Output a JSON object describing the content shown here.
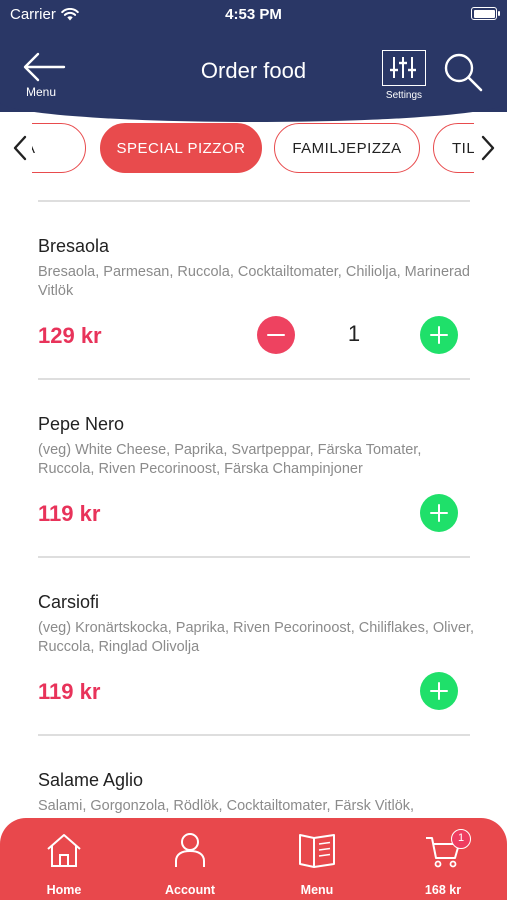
{
  "status_bar": {
    "carrier": "Carrier",
    "time": "4:53 PM"
  },
  "header": {
    "back_label": "Menu",
    "title": "Order food",
    "settings_label": "Settings"
  },
  "categories": {
    "tabs": [
      "PIZZA",
      "SPECIAL PIZZOR",
      "FAMILJEPIZZA",
      "TILLBEHÖR"
    ],
    "active_index": 1
  },
  "items": [
    {
      "name": "Bresaola",
      "description": "Bresaola, Parmesan, Ruccola, Cocktailtomater, Chiliolja, Marinerad Vitlök",
      "price": "129 kr",
      "quantity": "1"
    },
    {
      "name": "Pepe Nero",
      "description": "(veg) White Cheese, Paprika, Svartpeppar, Färska Tomater, Ruccola, Riven Pecorinoost, Färska Champinjoner",
      "price": "119 kr"
    },
    {
      "name": "Carsiofi",
      "description": "(veg) Kronärtskocka, Paprika, Riven Pecorinoost, Chiliflakes, Oliver, Ruccola, Ringlad Olivolja",
      "price": "119 kr"
    },
    {
      "name": "Salame Aglio",
      "description": "Salami, Gorgonzola, Rödlök, Cocktailtomater, Färsk Vitlök,"
    }
  ],
  "bottom_nav": {
    "home": "Home",
    "account": "Account",
    "menu": "Menu",
    "cart_total": "168 kr",
    "cart_count": "1"
  },
  "colors": {
    "header_bg": "#2a3766",
    "accent_red": "#e84b4d",
    "price": "#e8335a",
    "add_green": "#1fe06a"
  }
}
